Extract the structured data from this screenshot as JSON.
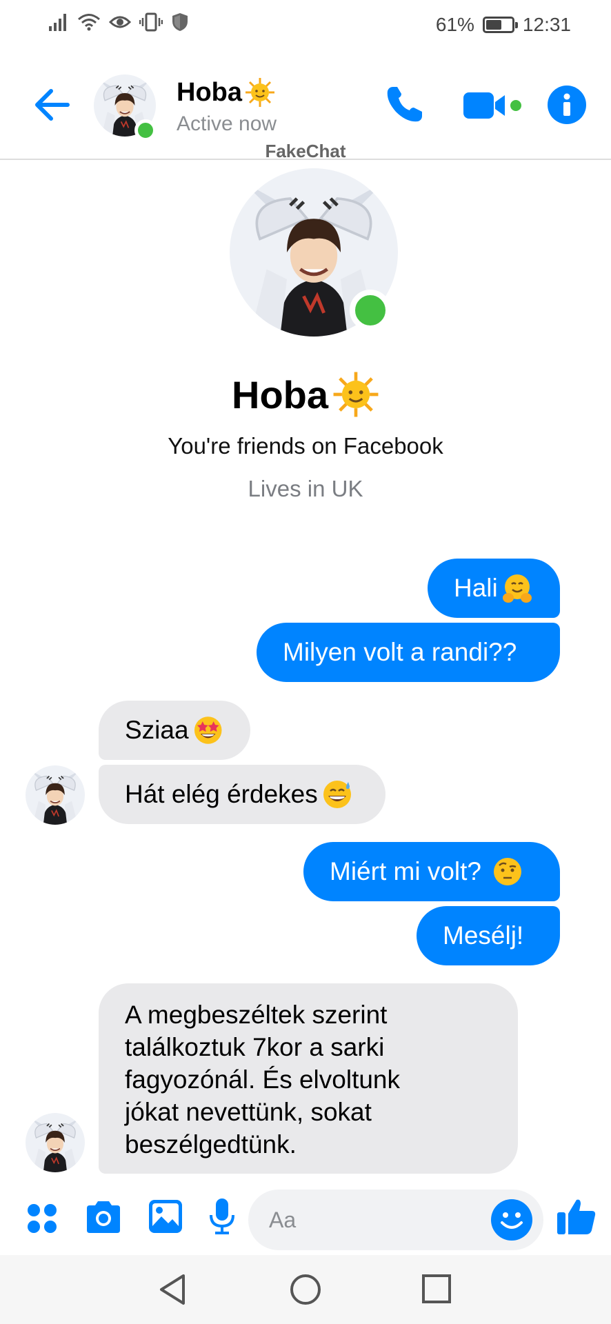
{
  "status_bar": {
    "battery": "61%",
    "battery_level": 0.61,
    "time": "12:31",
    "icons": [
      "signal-icon",
      "wifi-icon",
      "eye-icon",
      "vibrate-icon",
      "shield-icon",
      "battery-icon"
    ]
  },
  "header": {
    "name": "Hoba",
    "name_emoji": "sun-face-emoji",
    "status": "Active now",
    "watermark": "FakeChat",
    "buttons": [
      "back-arrow-icon",
      "phone-icon",
      "video-camera-icon",
      "info-icon"
    ]
  },
  "profile": {
    "name": "Hoba",
    "friends_text": "You're friends on Facebook",
    "lives_text": "Lives in UK"
  },
  "messages": [
    {
      "from": "me",
      "text": "Hali",
      "emoji": "hugging-face-emoji"
    },
    {
      "from": "me",
      "text": "Milyen volt a randi??"
    },
    {
      "from": "them",
      "text": "Sziaa",
      "emoji": "star-struck-emoji"
    },
    {
      "from": "them",
      "text": "Hát elég érdekes",
      "emoji": "grinning-sweat-emoji"
    },
    {
      "from": "me",
      "text": "Miért mi volt? ",
      "emoji": "raised-eyebrow-emoji"
    },
    {
      "from": "me",
      "text": "Mesélj!"
    },
    {
      "from": "them",
      "lines": [
        "A megbeszéltek szerint",
        "találkoztuk 7kor a sarki",
        "fagyozónál. És elvoltunk",
        "jókat nevettünk, sokat",
        "beszélgedtünk."
      ]
    }
  ],
  "composer": {
    "placeholder": "Aa",
    "icons": [
      "apps-icon",
      "camera-icon",
      "image-icon",
      "microphone-icon",
      "emoji-icon",
      "thumbs-up-icon"
    ]
  },
  "nav_bar": {
    "icons": [
      "back-triangle-icon",
      "home-circle-icon",
      "recents-square-icon"
    ]
  },
  "colors": {
    "accent": "#0084ff",
    "incoming_bubble": "#e9e9eb",
    "online": "#44c042"
  }
}
